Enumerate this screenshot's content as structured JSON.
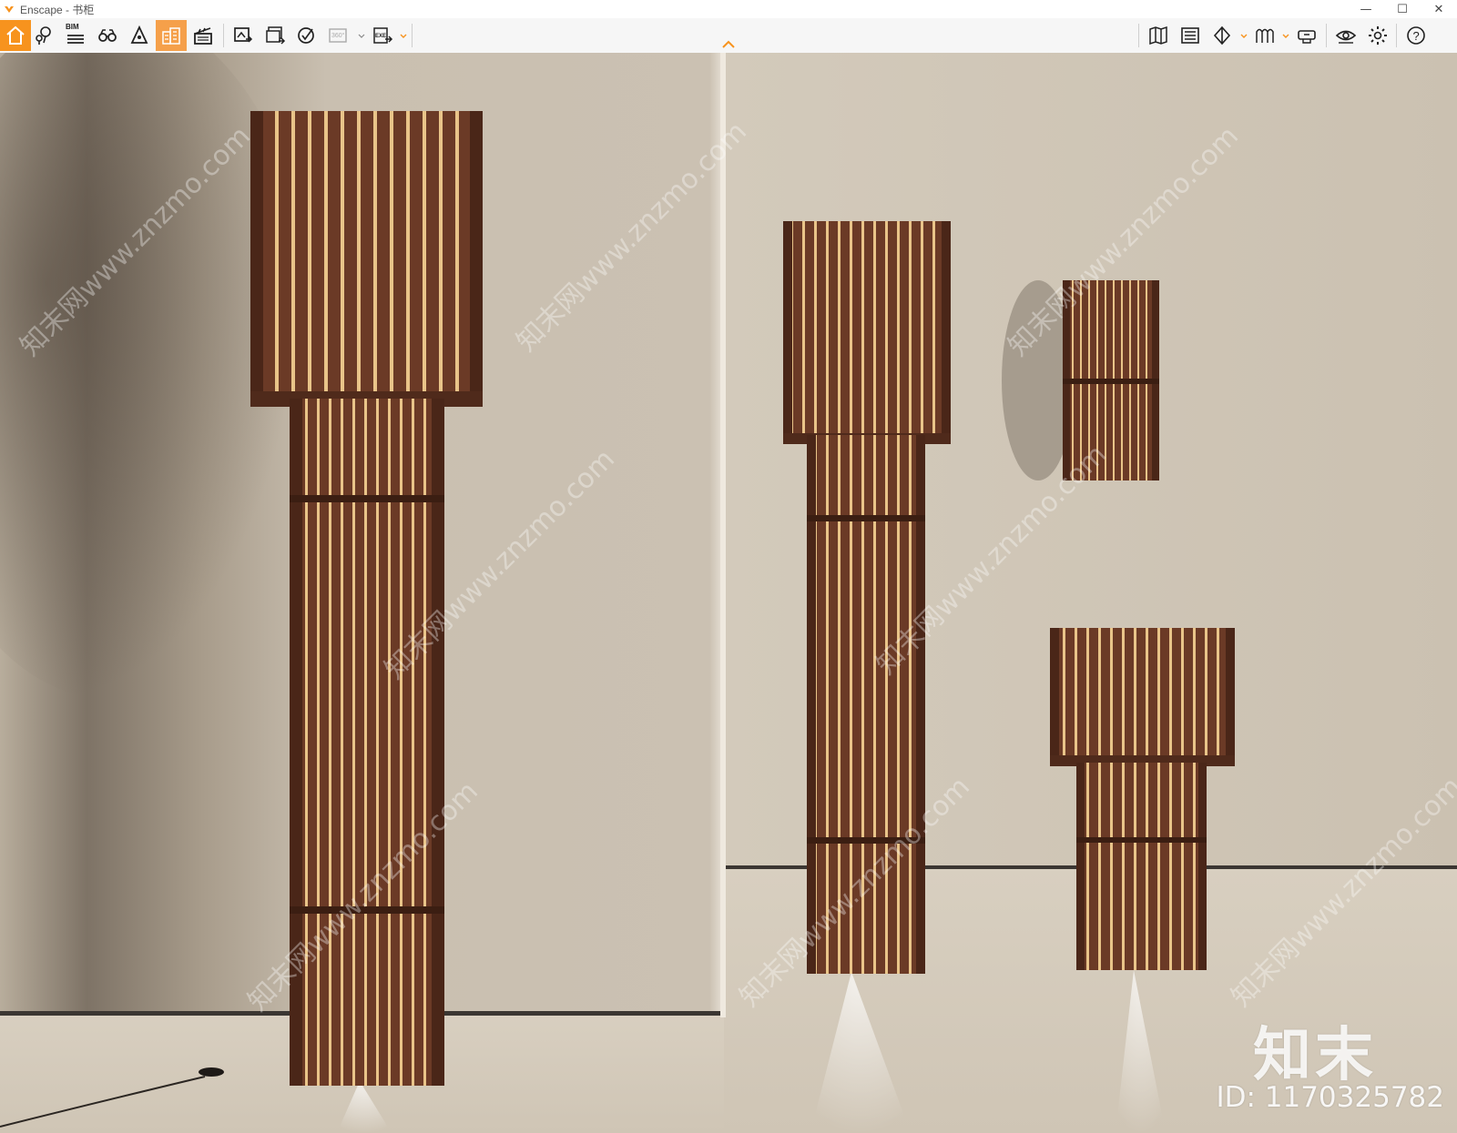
{
  "window": {
    "title": "Enscape - 书柜",
    "controls": {
      "minimize": "—",
      "maximize": "☐",
      "close": "✕"
    }
  },
  "toolbar": {
    "left_tools": [
      {
        "name": "home-icon",
        "active": true
      },
      {
        "name": "location-pins-icon"
      },
      {
        "name": "bim-icon",
        "label": "BIM"
      },
      {
        "name": "binoculars-icon"
      },
      {
        "name": "light-view-icon"
      },
      {
        "name": "buildings-icon",
        "active": true
      },
      {
        "name": "clapperboard-icon"
      },
      {
        "name": "render-image-icon"
      },
      {
        "name": "batch-render-icon"
      },
      {
        "name": "panorama-icon"
      },
      {
        "name": "render-360-icon",
        "label": "360°"
      },
      {
        "name": "export-exe-icon",
        "label": "EXE"
      }
    ],
    "right_tools": [
      {
        "name": "map-icon"
      },
      {
        "name": "asset-library-icon"
      },
      {
        "name": "sync-view-icon"
      },
      {
        "name": "material-editor-icon"
      },
      {
        "name": "vr-headset-icon"
      },
      {
        "name": "visual-settings-icon"
      },
      {
        "name": "settings-gear-icon"
      },
      {
        "name": "help-icon",
        "label": "?"
      }
    ],
    "accent": "#f7931e"
  },
  "viewport": {
    "watermark_brand": "知末",
    "watermark_id": "ID: 1170325782",
    "watermark_repeat": "知末网www.znzmo.com"
  }
}
